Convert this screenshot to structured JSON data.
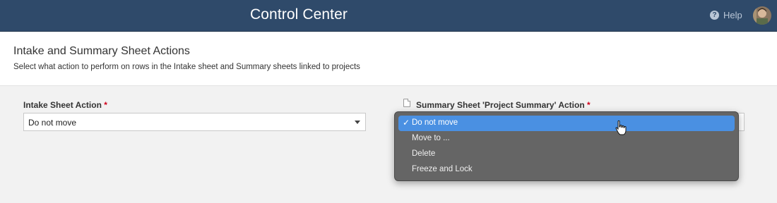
{
  "header": {
    "title": "Control Center",
    "help_label": "Help",
    "help_icon": "question-circle-icon"
  },
  "section": {
    "title": "Intake and Summary Sheet Actions",
    "subtitle": "Select what action to perform on rows in the Intake sheet and Summary sheets linked to projects"
  },
  "intake_field": {
    "label": "Intake Sheet Action",
    "required_mark": "*",
    "value": "Do not move"
  },
  "summary_field": {
    "label": "Summary Sheet 'Project Summary' Action",
    "required_mark": "*",
    "icon": "sheet-icon",
    "options": [
      "Do not move",
      "Move to ...",
      "Delete",
      "Freeze and Lock"
    ],
    "selected": "Do not move",
    "check_mark": "✓"
  },
  "colors": {
    "topbar": "#2f4a6a",
    "accent": "#4a90e2",
    "required": "#d0021b",
    "menu_bg": "#656565"
  }
}
